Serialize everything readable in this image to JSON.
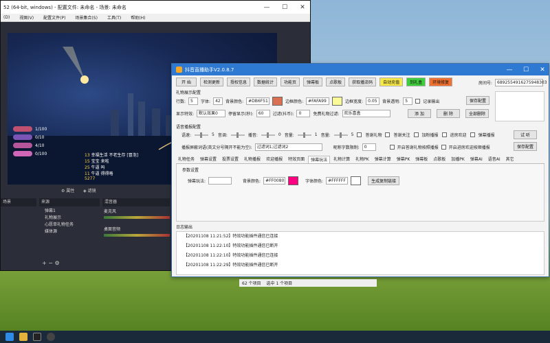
{
  "obs": {
    "title": "52 (64-bit, windows) - 配置文件: 未命名 - 场景: 未命名",
    "menu": [
      "(D)",
      "视图(V)",
      "配置文件(P)",
      "场景集合(S)",
      "工具(T)",
      "帮助(H)"
    ],
    "chat": [
      {
        "name": "幸福生活",
        "text": "不老生存 [冒泡]"
      },
      {
        "name": "宝宝",
        "text": "来啦"
      },
      {
        "name": "牛逼",
        "text": "吗"
      },
      {
        "name": "牛逼",
        "text": "得得咯"
      }
    ],
    "stats": [
      "1/100",
      "0/10",
      "4/10",
      "0/100"
    ],
    "chat_counter": [
      "13",
      "15",
      "25",
      "11",
      "5277"
    ],
    "dock": {
      "scenes_header": "场景",
      "sources_header": "来源",
      "mixer_header": "混音器",
      "sources": [
        "弹幕1",
        "礼物展示",
        "心愿单礼物任务",
        "媒体源"
      ],
      "mixer_tracks": [
        "麦克风",
        "桌面音频"
      ],
      "attr_label": "属性",
      "filter_label": "滤镜"
    }
  },
  "helper": {
    "title": "抖音直播助手V2.0.8.7",
    "toolbar": [
      "开 始",
      "检测更新",
      "授权信息",
      "数据统计",
      "功能页",
      "弹幕板",
      "点歌板",
      "获取播流码"
    ],
    "colored_buttons": [
      {
        "label": "自动充值",
        "color": "#f7e84a"
      },
      {
        "label": "到礼盒",
        "color": "#3fcd3c"
      },
      {
        "label": "环境修复",
        "color": "#f07030"
      }
    ],
    "room_label": "房间号:",
    "room_id": "6892554916275948303",
    "gift_section": {
      "label": "礼物展示配置",
      "rows_label": "行数:",
      "rows": "5",
      "font_label": "字体:",
      "font_size": "42",
      "bg_label": "背景颜色:",
      "bg_color": "#DB6F51",
      "border_label": "边框颜色:",
      "border_color": "#FAFA99",
      "border_width_label": "边框宽度:",
      "border_width": "0.05",
      "bg_alpha_label": "背景透明:",
      "bg_alpha": "5",
      "record_label": "记录输出",
      "save": "保存配置",
      "effect_label": "显示特效:",
      "effect": "默认效果0",
      "stay_label": "停留显示(秒):",
      "stay": "60",
      "filter_label": "过滤(抖币):",
      "filter": "0",
      "free_label": "免费礼物过滤:",
      "free": "欢乐喜盒",
      "add": "添 加",
      "delete": "删 除",
      "delete_all": "全部删除"
    },
    "voice_section": {
      "label": "语音播报配置",
      "rate_label": "语速:",
      "rate": "5",
      "volume_label": "音调:",
      "speak_label": "播音:",
      "speak": "0",
      "voice_label": "音量:",
      "voice_value": "1",
      "level_label": "音量:",
      "level": "5",
      "checks": [
        "答谢礼物",
        "答谢关注",
        "加粉播报",
        "进房欢迎",
        "弹幕播报"
      ],
      "test": "试 听",
      "filter_words_label": "播报屏蔽词语(英文分号隔开不能为空):",
      "filter_words": "过滤词1;过滤词2",
      "limit_label": "昵称字数限制:",
      "limit": "0",
      "checks2": [
        "开启答谢礼物按照播报",
        "开启进房欢迎按顺播报"
      ],
      "save": "保存配置"
    },
    "tabs": [
      "礼物任务",
      "弹幕设置",
      "投票设置",
      "礼物播报",
      "欢迎播报",
      "特效页面",
      "弹幕玩法",
      "礼物计算",
      "礼物PK",
      "弹幕计算",
      "弹幕PK",
      "弹幕板",
      "点歌板",
      "加播PK",
      "弹幕AI",
      "语音AI",
      "其它"
    ],
    "active_tab": 6,
    "params": {
      "label": "参数设置",
      "play_label": "弹幕玩法:",
      "bg_label": "背景颜色:",
      "bg_color": "#FF0080",
      "font_color_label": "字体颜色:",
      "font_color": "#FFFFFF",
      "gen_link": "生成复制链接"
    },
    "log": {
      "label": "日志输出",
      "lines": [
        "【20201108 11:21:52】特效功能插件通信已连接",
        "【20201108 11:22:10】特效功能插件通信已断开",
        "【20201108 11:22:10】特效功能插件通信已连接",
        "【20201108 11:22:29】特效功能插件通信已断开"
      ]
    }
  },
  "explorer_status": {
    "items": "62 个项目",
    "selected": "选中 1 个项目"
  }
}
